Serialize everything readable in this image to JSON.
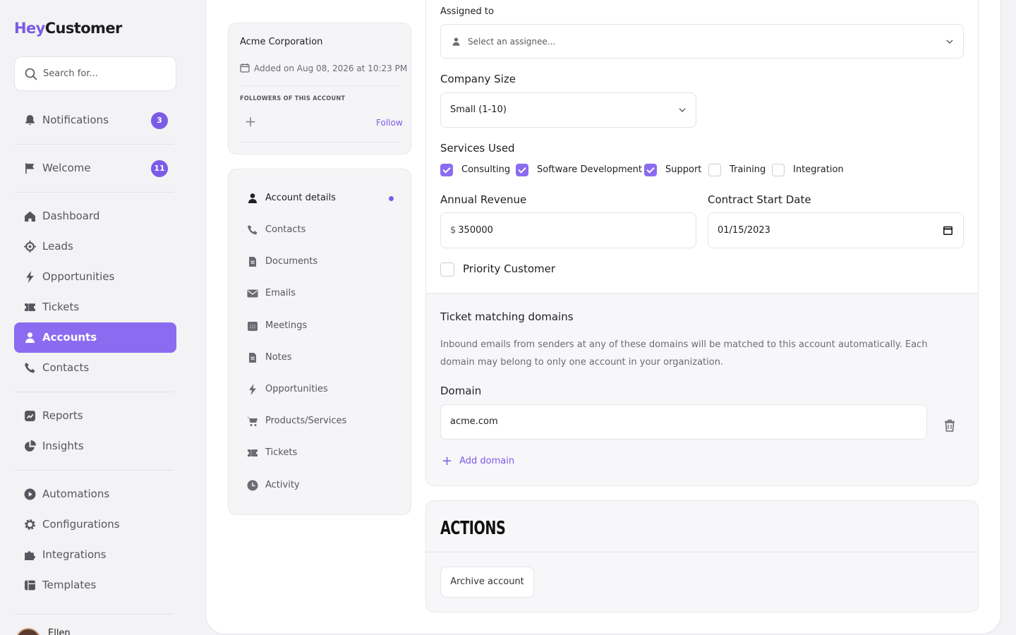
{
  "brand": {
    "part1": "Hey",
    "part2": "Customer"
  },
  "search": {
    "placeholder": "Search for..."
  },
  "sidebar": {
    "notifications": {
      "label": "Notifications",
      "count": "3"
    },
    "welcome": {
      "label": "Welcome",
      "count": "11"
    },
    "items": [
      {
        "label": "Dashboard"
      },
      {
        "label": "Leads"
      },
      {
        "label": "Opportunities"
      },
      {
        "label": "Tickets"
      },
      {
        "label": "Accounts"
      },
      {
        "label": "Contacts"
      },
      {
        "label": "Reports"
      },
      {
        "label": "Insights"
      },
      {
        "label": "Automations"
      },
      {
        "label": "Configurations"
      },
      {
        "label": "Integrations"
      },
      {
        "label": "Templates"
      }
    ],
    "user_name": "Ellen"
  },
  "account": {
    "name": "Acme Corporation",
    "added": "Added on Aug 08, 2026 at 10:23 PM",
    "followers_title": "FOLLOWERS OF THIS ACCOUNT",
    "add_follower": "+",
    "follow_label": "Follow"
  },
  "account_menu": [
    {
      "label": "Account details",
      "icon": "person-icon"
    },
    {
      "label": "Contacts",
      "icon": "phone-icon"
    },
    {
      "label": "Documents",
      "icon": "document-icon"
    },
    {
      "label": "Emails",
      "icon": "envelope-icon"
    },
    {
      "label": "Meetings",
      "icon": "calendar-icon"
    },
    {
      "label": "Notes",
      "icon": "note-icon"
    },
    {
      "label": "Opportunities",
      "icon": "bolt-icon"
    },
    {
      "label": "Products/Services",
      "icon": "cart-icon"
    },
    {
      "label": "Tickets",
      "icon": "ticket-icon"
    },
    {
      "label": "Activity",
      "icon": "clock-icon"
    }
  ],
  "form": {
    "assigned_to": {
      "label": "Assigned to",
      "placeholder": "Select an assignee..."
    },
    "company_size": {
      "label": "Company Size",
      "value": "Small (1-10)"
    },
    "services": {
      "label": "Services Used",
      "options": [
        {
          "label": "Consulting",
          "checked": true
        },
        {
          "label": "Software Development",
          "checked": true
        },
        {
          "label": "Support",
          "checked": true
        },
        {
          "label": "Training",
          "checked": false
        },
        {
          "label": "Integration",
          "checked": false
        }
      ]
    },
    "annual_revenue": {
      "label": "Annual Revenue",
      "prefix": "$",
      "value": "350000"
    },
    "contract_start": {
      "label": "Contract Start Date",
      "value": "01/15/2023"
    },
    "priority": {
      "label": "Priority Customer",
      "checked": false
    },
    "ticket_domains": {
      "title": "Ticket matching domains",
      "description": "Inbound emails from senders at any of these domains will be matched to this account automatically. Each domain may belong to only one account in your organization.",
      "domain_label": "Domain",
      "domain_value": "acme.com",
      "add_label": "Add domain"
    }
  },
  "actions": {
    "title": "ACTIONS",
    "archive_label": "Archive account"
  },
  "colors": {
    "accent": "#8b6cf0",
    "accent_dark": "#7b5be6"
  }
}
